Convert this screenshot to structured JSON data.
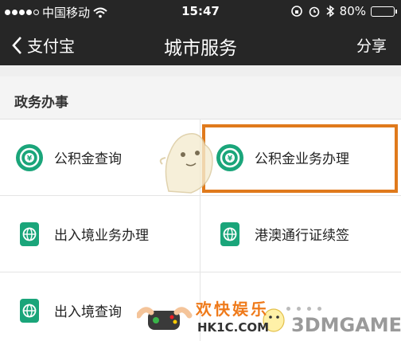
{
  "status_bar": {
    "carrier": "中国移动",
    "time": "15:47",
    "battery": "80%",
    "battery_level": 0.8,
    "wifi_icon": "wifi-icon",
    "alarm_icon": "alarm-icon",
    "bluetooth_icon": "bluetooth-icon"
  },
  "nav": {
    "back_label": "支付宝",
    "title": "城市服务",
    "share_label": "分享"
  },
  "section": {
    "title": "政务办事"
  },
  "services": [
    {
      "label": "公积金查询",
      "icon": "fund-coin-icon"
    },
    {
      "label": "公积金业务办理",
      "icon": "fund-coin-icon"
    },
    {
      "label": "出入境业务办理",
      "icon": "globe-card-icon"
    },
    {
      "label": "港澳通行证续签",
      "icon": "globe-card-icon"
    },
    {
      "label": "出入境查询",
      "icon": "globe-card-icon"
    }
  ],
  "watermark": {
    "kuaile": "欢快娱乐",
    "site": "HK1C.COM",
    "brand": "3DMGAME"
  },
  "colors": {
    "bar_bg": "#262626",
    "icon_green": "#1aa57a",
    "highlight": "#e07a1c"
  }
}
